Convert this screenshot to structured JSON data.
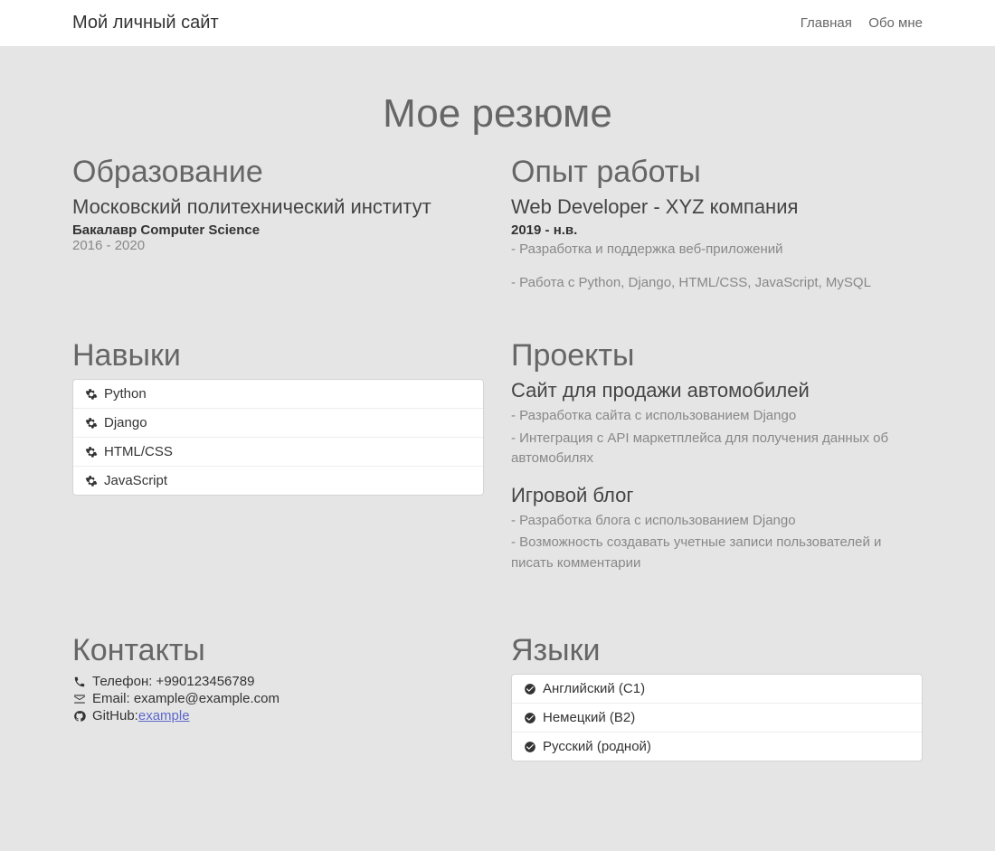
{
  "header": {
    "brand": "Мой личный сайт",
    "nav": {
      "home": "Главная",
      "about": "Обо мне"
    }
  },
  "page_title": "Мое резюме",
  "education": {
    "heading": "Образование",
    "school": "Московский политехнический институт",
    "degree": "Бакалавр Computer Science",
    "years": "2016 - 2020"
  },
  "experience": {
    "heading": "Опыт работы",
    "title": "Web Developer - XYZ компания",
    "period": "2019 - н.в.",
    "b1": "- Разработка и поддержка веб-приложений",
    "b2": "- Работа с Python, Django, HTML/CSS, JavaScript, MySQL"
  },
  "skills": {
    "heading": "Навыки",
    "s1": "Python",
    "s2": "Django",
    "s3": "HTML/CSS",
    "s4": "JavaScript"
  },
  "projects": {
    "heading": "Проекты",
    "p1": {
      "title": "Сайт для продажи автомобилей",
      "b1": "- Разработка сайта с использованием Django",
      "b2": "- Интеграция с API маркетплейса для получения данных об автомобилях"
    },
    "p2": {
      "title": "Игровой блог",
      "b1": "- Разработка блога с использованием Django",
      "b2": "- Возможность создавать учетные записи пользователей и писать комментарии"
    }
  },
  "contacts": {
    "heading": "Контакты",
    "phone_label": "Телефон: +990123456789",
    "email_label": "Email: example@example.com",
    "github_label": "GitHub:",
    "github_link": "example"
  },
  "languages": {
    "heading": "Языки",
    "l1": "Английский (C1)",
    "l2": "Немецкий (B2)",
    "l3": "Русский (родной)"
  }
}
